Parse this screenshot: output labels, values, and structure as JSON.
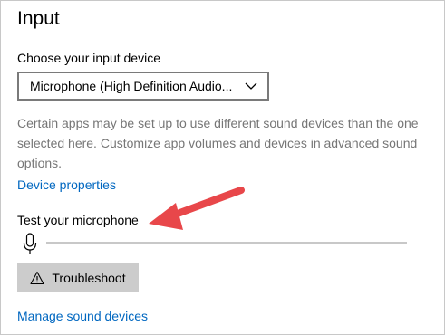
{
  "section": {
    "title": "Input"
  },
  "device": {
    "label": "Choose your input device",
    "selected": "Microphone (High Definition Audio...",
    "chevron_icon": "chevron-down-icon"
  },
  "description": "Certain apps may be set up to use different sound devices than the one selected here. Customize app volumes and devices in advanced sound options.",
  "links": {
    "device_properties": "Device properties",
    "manage_sound_devices": "Manage sound devices"
  },
  "test": {
    "label": "Test your microphone",
    "mic_icon": "microphone-icon",
    "level": 0
  },
  "troubleshoot": {
    "label": "Troubleshoot",
    "icon": "warning-icon"
  },
  "annotation": {
    "arrow_color": "#e8474a"
  },
  "colors": {
    "link": "#0067c0",
    "description": "#767676",
    "button_bg": "#cccccc"
  }
}
